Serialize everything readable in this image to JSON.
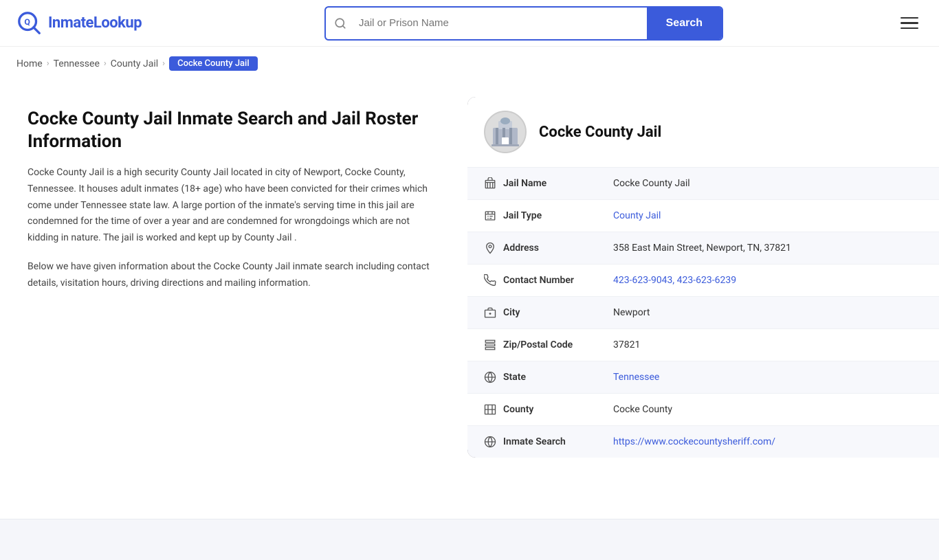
{
  "header": {
    "logo_text_prefix": "Inmate",
    "logo_text_suffix": "Lookup",
    "search_placeholder": "Jail or Prison Name",
    "search_button_label": "Search"
  },
  "breadcrumb": {
    "items": [
      {
        "label": "Home",
        "href": "#"
      },
      {
        "label": "Tennessee",
        "href": "#"
      },
      {
        "label": "County Jail",
        "href": "#"
      }
    ],
    "active": "Cocke County Jail"
  },
  "left": {
    "title": "Cocke County Jail Inmate Search and Jail Roster Information",
    "description": "Cocke County Jail is a high security County Jail located in city of Newport, Cocke County, Tennessee. It houses adult inmates (18+ age) who have been convicted for their crimes which come under Tennessee state law. A large portion of the inmate's serving time in this jail are condemned for the time of over a year and are condemned for wrongdoings which are not kidding in nature. The jail is worked and kept up by County Jail .",
    "sub_description": "Below we have given information about the Cocke County Jail inmate search including contact details, visitation hours, driving directions and mailing information."
  },
  "card": {
    "title": "Cocke County Jail",
    "avatar_alt": "Cocke County Jail building",
    "rows": [
      {
        "icon": "jail-icon",
        "label": "Jail Name",
        "value": "Cocke County Jail",
        "link": null
      },
      {
        "icon": "type-icon",
        "label": "Jail Type",
        "value": "County Jail",
        "link": "#"
      },
      {
        "icon": "address-icon",
        "label": "Address",
        "value": "358 East Main Street, Newport, TN, 37821",
        "link": null
      },
      {
        "icon": "phone-icon",
        "label": "Contact Number",
        "value": "423-623-9043, 423-623-6239",
        "link": "#"
      },
      {
        "icon": "city-icon",
        "label": "City",
        "value": "Newport",
        "link": null
      },
      {
        "icon": "zip-icon",
        "label": "Zip/Postal Code",
        "value": "37821",
        "link": null
      },
      {
        "icon": "state-icon",
        "label": "State",
        "value": "Tennessee",
        "link": "#"
      },
      {
        "icon": "county-icon",
        "label": "County",
        "value": "Cocke County",
        "link": null
      },
      {
        "icon": "web-icon",
        "label": "Inmate Search",
        "value": "https://www.cockecountysheriff.com/",
        "link": "https://www.cockecountysheriff.com/"
      }
    ]
  }
}
